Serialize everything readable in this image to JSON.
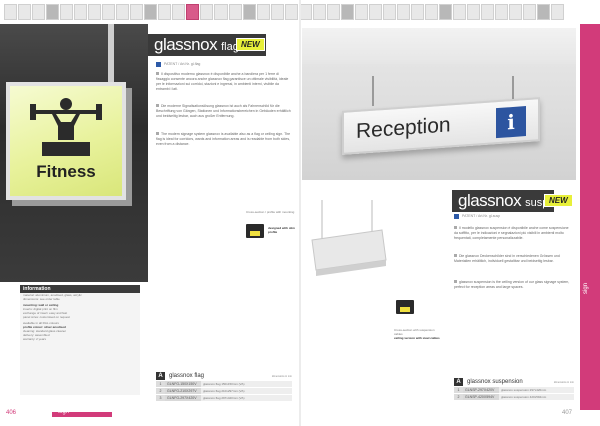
{
  "left": {
    "title": "glassnox",
    "subtitle": "flag",
    "badge": "NEW",
    "patent_line": "PATENT / Art.Nr. gl-flag",
    "sign_text": "Fitness",
    "paragraphs": [
      "Il dispositivo moderno glassnox è disponibile anche a bandiera per 1 ferre di fissaggio consente ancora anche glassnox flag garantisce un ottimale visibilità, ideale per le informazioni sui corridoi, stazioni e ingressi, in ambienti interni, visibile da entrambi i lati.",
      "Die moderne Signalisationslösung glassnox ist auch als Fahnenschild für die Beschriftung von Gängen, Stationen und Informationsbereichen in Gebäuden erhältlich und beidseitig lesbar, auch aus großer Entfernung.",
      "The modern signage system glassnox is available also as a flag or ceiling sign. The flag is ideal for corridors, wards and information areas and is readable from both sides, even from a distance."
    ],
    "callout_text": "Cross-section / profile with mounting",
    "callout_bold": "designed with slim profile",
    "info": {
      "heading": "information",
      "rows": [
        "material: aluminium, anodised, glass, acrylic",
        "dimensions: see order table",
        "mounting: wall or ceiling",
        "inserts: digital print on film",
        "exchange of insert: easy and fast",
        "panel sizes: customised on request",
        "available in all RAL colours",
        "profile colour: silver anodised",
        "cleaning: standard glass cleaner",
        "delivery: assembled",
        "warranty: 2 years"
      ]
    },
    "order": {
      "letter": "A",
      "title": "glassnox flag",
      "note": "dimensions in mm",
      "rows": [
        {
          "num": "1",
          "code": "GLNFG-150X150V",
          "desc": "glassnox flag 150x150mm (VA)"
        },
        {
          "num": "2",
          "code": "GLNFG-210X297V",
          "desc": "glassnox flag 210x297mm (VA)"
        },
        {
          "num": "3",
          "code": "GLNFG-297X420V",
          "desc": "glassnox flag 297x420mm (VA)"
        }
      ]
    },
    "page_number": "406",
    "section": "sign"
  },
  "right": {
    "title": "glassnox",
    "subtitle": "suspension",
    "badge": "NEW",
    "patent_line": "PATENT / Art.Nr. gl-susp",
    "sign_text": "Reception",
    "sign_icon": "i",
    "paragraphs": [
      "Il modello glassnox suspension è disponibile anche come sospensione da soffitto, per le indicazioni e segnalazioni più visibili in ambienti molto frequentati, completamente personalizzabile.",
      "Die glassnox Deckenschilder sind in verschiedenen Grössen und Materialien erhältlich, individuell gestaltbar und beidseitig lesbar.",
      "glassnox suspension is the ceiling version of our glass signage system, perfect for reception areas and large spaces."
    ],
    "callout_text": "Cross-section with suspension cables",
    "callout_bold": "ceiling version with steel cables",
    "order": {
      "letter": "A",
      "title": "glassnox suspension",
      "note": "dimensions in mm",
      "rows": [
        {
          "num": "1",
          "code": "GLNSP-297X420V",
          "desc": "glassnox suspension 297x420mm"
        },
        {
          "num": "2",
          "code": "GLNSP-420X594V",
          "desc": "glassnox suspension 420x594mm"
        }
      ]
    },
    "side_label": "sign",
    "page_number": "407"
  }
}
